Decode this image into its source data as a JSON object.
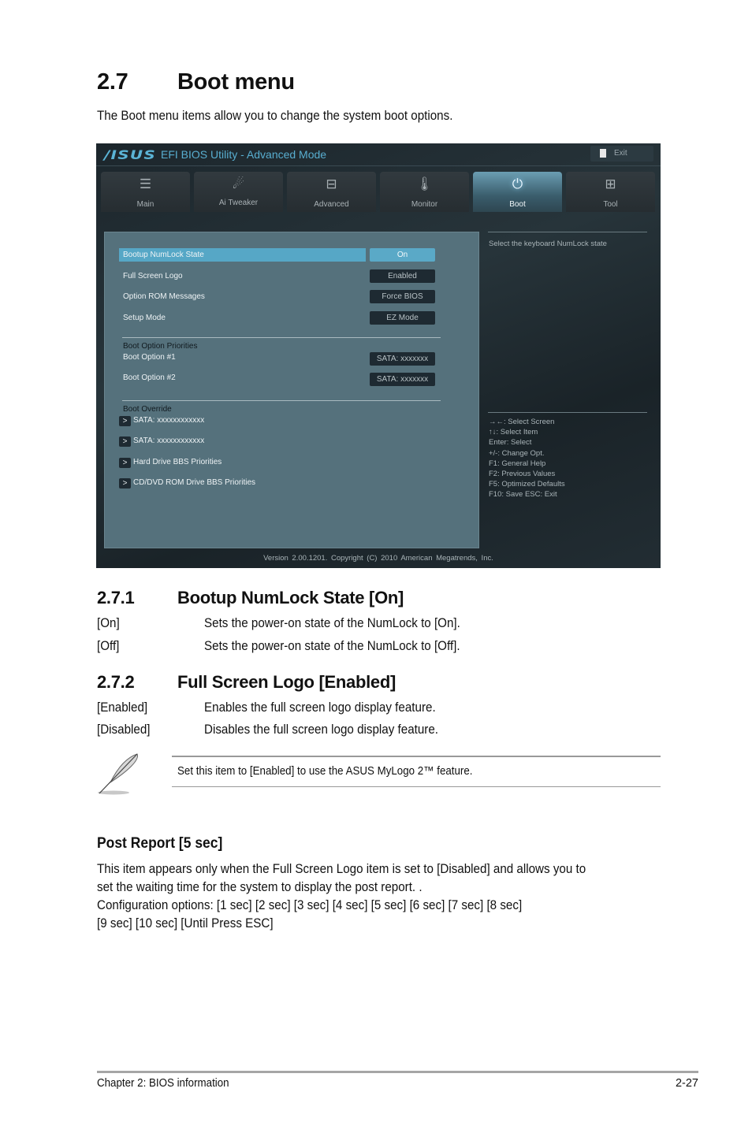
{
  "doc": {
    "section_number": "2.7",
    "section_title": "Boot menu",
    "intro": "The Boot menu items allow you to change the system boot options."
  },
  "bios": {
    "logo": "/ISUS",
    "title": "EFI BIOS Utility - Advanced Mode",
    "exit_label": "Exit",
    "tabs": [
      {
        "label": "Main",
        "icon": "list-icon",
        "glyph": "☰"
      },
      {
        "label": "Ai  Tweaker",
        "icon": "ai-tweaker-icon",
        "glyph": "☄"
      },
      {
        "label": "Advanced",
        "icon": "advanced-icon",
        "glyph": "⊟"
      },
      {
        "label": "Monitor",
        "icon": "monitor-icon",
        "glyph": "🌡"
      },
      {
        "label": "Boot",
        "icon": "power-icon",
        "glyph": "⏻"
      },
      {
        "label": "Tool",
        "icon": "toolbox-icon",
        "glyph": "⊞"
      }
    ],
    "active_tab": "Boot",
    "settings": [
      {
        "label": "Bootup NumLock State",
        "value": "On"
      },
      {
        "label": "Full Screen Logo",
        "value": "Enabled"
      },
      {
        "label": "Option ROM Messages",
        "value": "Force BIOS"
      },
      {
        "label": "Setup Mode",
        "value": "EZ Mode"
      }
    ],
    "boot_priorities": {
      "title": "Boot Option Priorities",
      "items": [
        {
          "label": "Boot Option #1",
          "value": "SATA: xxxxxxx"
        },
        {
          "label": "Boot Option #2",
          "value": "SATA: xxxxxxx"
        }
      ]
    },
    "boot_override": {
      "title": "Boot Override",
      "arrow": ">",
      "items": [
        "SATA: xxxxxxxxxxxx",
        "SATA: xxxxxxxxxxxx",
        "Hard Drive BBS Priorities",
        "CD/DVD ROM Drive BBS Priorities"
      ]
    },
    "help_text": "Select the keyboard NumLock state",
    "keys": [
      "→←:  Select Screen",
      "↑↓:  Select Item",
      "Enter:  Select",
      "+/-:  Change Opt.",
      "F1:  General Help",
      "F2:  Previous Values",
      "F5:  Optimized Defaults",
      "F10:  Save    ESC:  Exit"
    ],
    "footer": "Version  2.00.1201.  Copyright  (C)  2010  American  Megatrends,  Inc."
  },
  "sub1": {
    "number": "2.7.1",
    "title": "Bootup NumLock State [On]",
    "options": [
      {
        "key": "[On]",
        "desc": "Sets the power-on state of the NumLock to [On]."
      },
      {
        "key": "[Off]",
        "desc": "Sets the power-on state of the NumLock to [Off]."
      }
    ]
  },
  "sub2": {
    "number": "2.7.2",
    "title": "Full Screen Logo [Enabled]",
    "options": [
      {
        "key": "[Enabled]",
        "desc": "Enables the full screen logo display feature."
      },
      {
        "key": "[Disabled]",
        "desc": "Disables the full screen logo display feature."
      }
    ]
  },
  "note": "Set this item to [Enabled] to use the ASUS MyLogo 2™ feature.",
  "post_report": {
    "title": "Post Report [5 sec]",
    "lines": [
      "This item appears only when the Full Screen Logo item is set to [Disabled] and allows you to",
      "set the waiting time for the system to display the post report. .",
      "Configuration options: [1 sec] [2 sec] [3 sec] [4 sec] [5 sec] [6 sec] [7 sec] [8 sec]",
      "[9 sec] [10 sec] [Until Press ESC]"
    ]
  },
  "footer": {
    "chapter": "Chapter 2: BIOS information",
    "page": "2-27"
  },
  "colors": {
    "accent": "#56a7c6",
    "panel": "#55717c",
    "title_blue": "#58aed0"
  }
}
